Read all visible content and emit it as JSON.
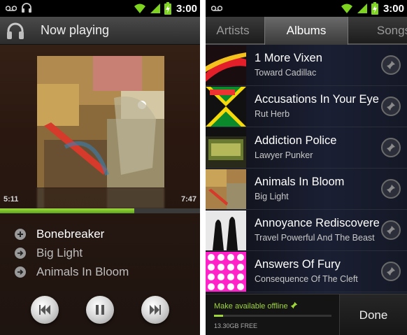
{
  "status_bar": {
    "time": "3:00"
  },
  "now_playing": {
    "title": "Now playing",
    "elapsed": "5:11",
    "duration": "7:47",
    "progress_fraction": 0.67,
    "queue": [
      {
        "label": "Bonebreaker",
        "icon": "add-icon",
        "current": true
      },
      {
        "label": "Big Light",
        "icon": "arrow-right-icon",
        "current": false
      },
      {
        "label": "Animals In Bloom",
        "icon": "arrow-right-icon",
        "current": false
      }
    ],
    "controls": [
      "previous-icon",
      "pause-icon",
      "next-icon"
    ]
  },
  "library": {
    "tabs": [
      {
        "label": "Artists",
        "active": false
      },
      {
        "label": "Albums",
        "active": true
      },
      {
        "label": "Songs",
        "active": false
      }
    ],
    "albums": [
      {
        "title": "1 More Vixen",
        "artist": "Toward Cadillac"
      },
      {
        "title": "Accusations In Your Eyes",
        "artist": "Rut Herb"
      },
      {
        "title": "Addiction Police",
        "artist": "Lawyer Punker"
      },
      {
        "title": "Animals In Bloom",
        "artist": "Big Light"
      },
      {
        "title": "Annoyance Rediscovered",
        "artist": "Travel Powerful And The Beast"
      },
      {
        "title": "Answers Of Fury",
        "artist": "Consequence Of The Cleft"
      }
    ],
    "offline_label": "Make available offline",
    "storage_free": "13.30GB FREE",
    "done_label": "Done",
    "accent_color": "#9fd63a"
  }
}
